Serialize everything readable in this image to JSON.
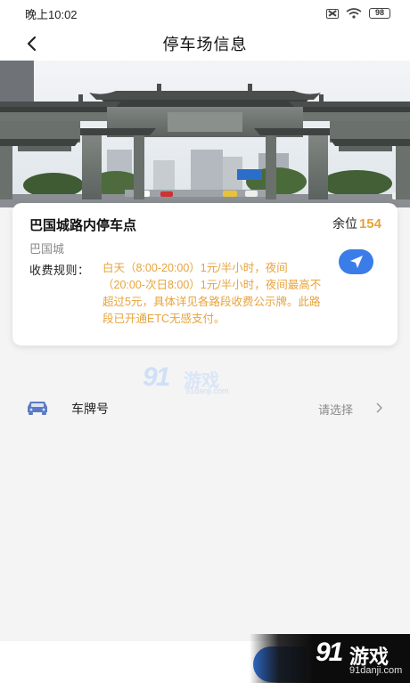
{
  "status_bar": {
    "time": "晚上10:02",
    "battery": "98"
  },
  "nav": {
    "title": "停车场信息"
  },
  "lot": {
    "name": "巴国城路内停车点",
    "spaces_label": "余位",
    "spaces_count": "154",
    "district": "巴国城",
    "fee_label": "收费规则：",
    "fee_text": "白天（8:00-20:00）1元/半小时，夜间（20:00-次日8:00）1元/半小时，夜间最高不超过5元，具体详见各路段收费公示牌。此路段已开通ETC无感支付。"
  },
  "plate": {
    "label": "车牌号",
    "value": "请选择"
  },
  "watermark": {
    "brand_number": "91",
    "brand_text": "游戏",
    "domain": "91danji.com"
  },
  "colors": {
    "accent_orange": "#e8a33a",
    "accent_blue": "#3a7de8"
  },
  "icons": {
    "back": "chevron-left-icon",
    "navigate": "navigation-arrow-icon",
    "car": "car-icon",
    "chevron": "chevron-right-icon"
  }
}
